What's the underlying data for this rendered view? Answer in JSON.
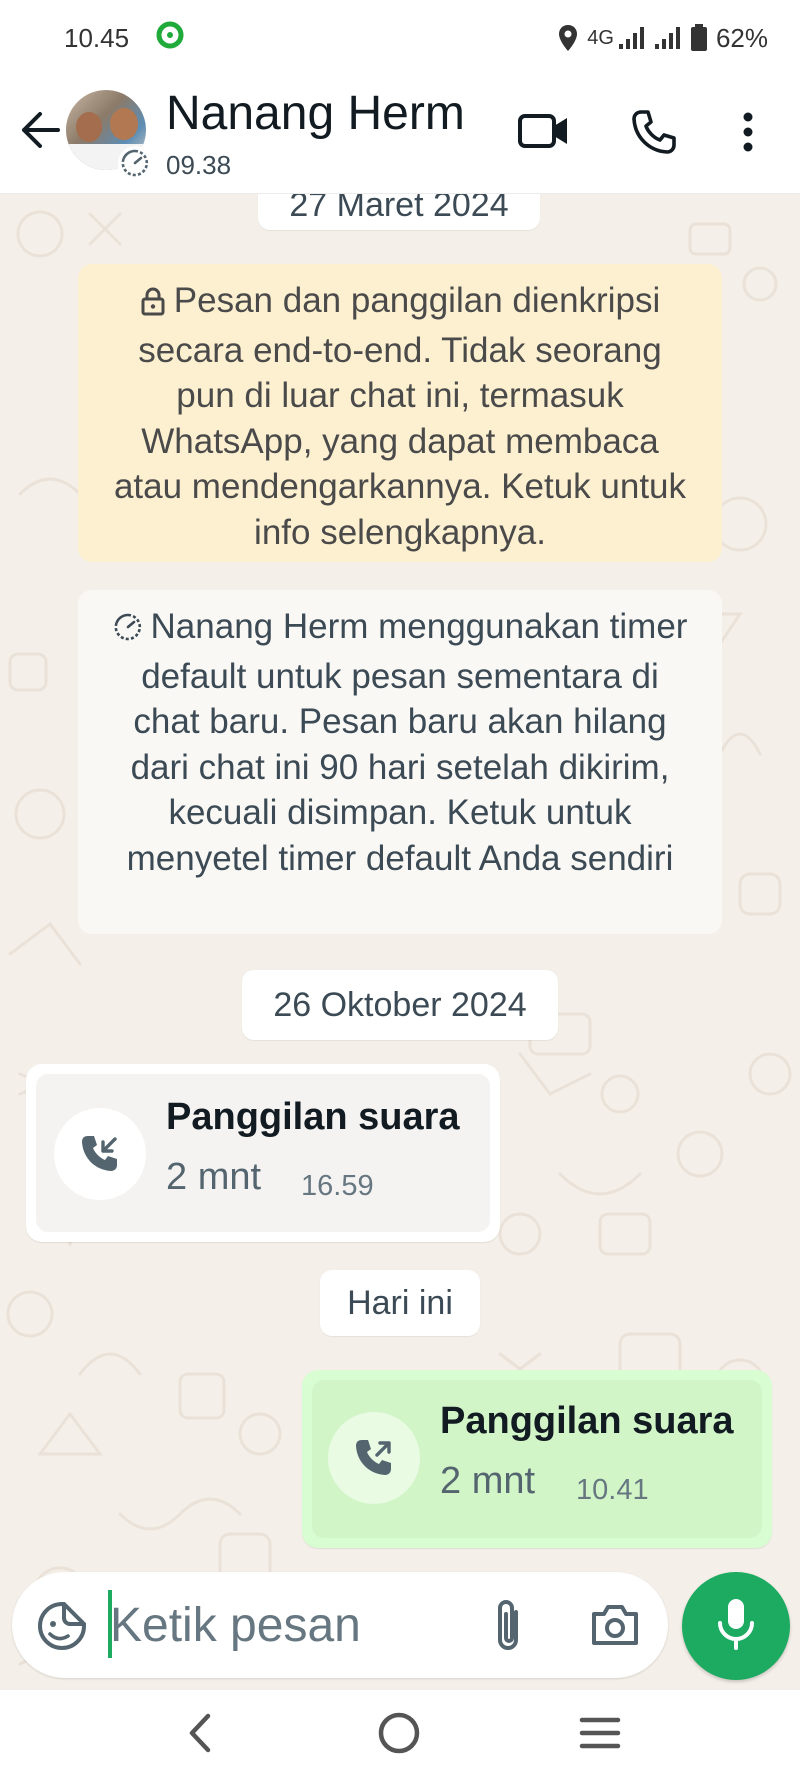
{
  "status_bar": {
    "time": "10.45",
    "network": "4G",
    "battery": "62%",
    "icons": [
      "ring-app-icon",
      "location-icon",
      "signal-icon",
      "signal-icon",
      "battery-icon"
    ]
  },
  "header": {
    "contact_name": "Nanang Herm",
    "status": "09.38",
    "icons": [
      "back-arrow-icon",
      "video-call-icon",
      "phone-icon",
      "more-vert-icon",
      "disappearing-timer-icon"
    ]
  },
  "chat": {
    "date_1": "27 Maret 2024",
    "encryption_notice": "Pesan dan panggilan dienkripsi secara end-to-end. Tidak seorang pun di luar chat ini, termasuk WhatsApp, yang dapat membaca atau mendengarkannya. Ketuk untuk info selengkapnya.",
    "timer_notice": "Nanang Herm menggunakan timer default untuk pesan sementara di chat baru. Pesan baru akan hilang dari chat ini 90 hari setelah dikirim, kecuali disimpan. Ketuk untuk menyetel timer default Anda sendiri",
    "date_2": "26 Oktober 2024",
    "incoming_call": {
      "title": "Panggilan suara",
      "duration": "2 mnt",
      "time": "16.59",
      "icon": "incoming-call-icon"
    },
    "date_3": "Hari ini",
    "outgoing_call": {
      "title": "Panggilan suara",
      "duration": "2 mnt",
      "time": "10.41",
      "icon": "outgoing-call-icon"
    }
  },
  "composer": {
    "placeholder": "Ketik pesan",
    "icons": [
      "sticker-icon",
      "attach-icon",
      "camera-icon",
      "mic-icon"
    ]
  },
  "colors": {
    "accent_green": "#1daa61",
    "outgoing_bubble": "#d9fdd3",
    "encryption_bubble": "#fdf0d0",
    "chat_background": "#f4efe8"
  }
}
